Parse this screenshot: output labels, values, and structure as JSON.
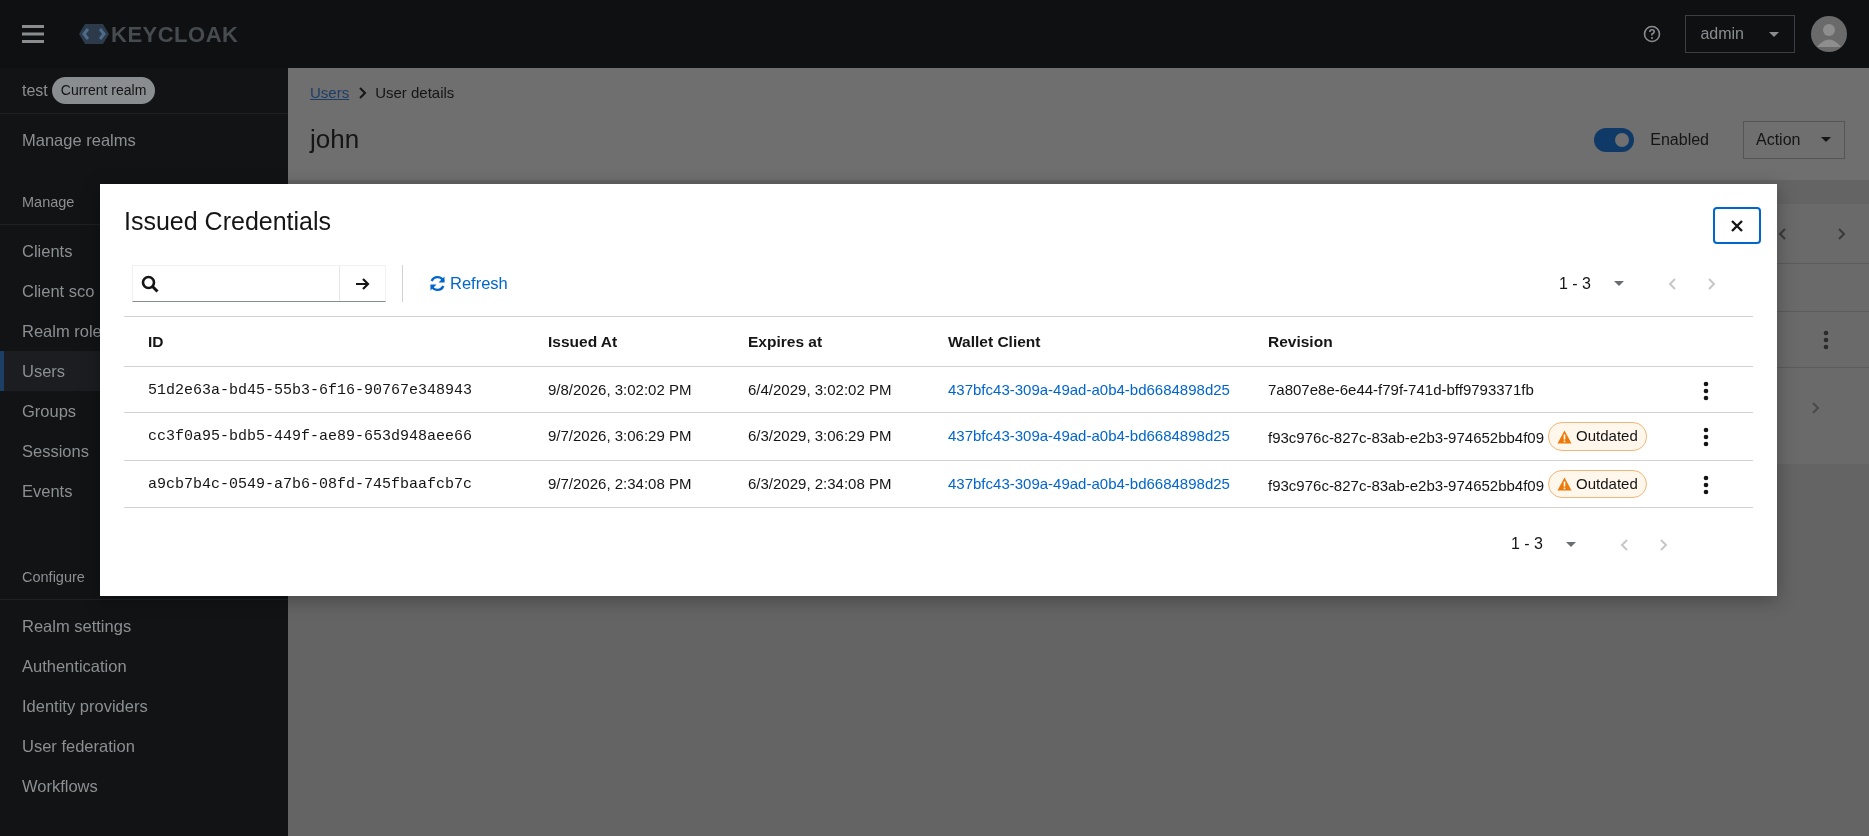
{
  "masthead": {
    "brand": "KEYCLOAK",
    "user": "admin"
  },
  "sidebar": {
    "realm": "test",
    "realm_badge": "Current realm",
    "manage_realms": "Manage realms",
    "sections": [
      {
        "title": "Manage",
        "items": [
          {
            "label": "Clients",
            "selected": false
          },
          {
            "label": "Client sco",
            "selected": false
          },
          {
            "label": "Realm role",
            "selected": false
          },
          {
            "label": "Users",
            "selected": true
          },
          {
            "label": "Groups",
            "selected": false
          },
          {
            "label": "Sessions",
            "selected": false
          },
          {
            "label": "Events",
            "selected": false
          }
        ]
      },
      {
        "title": "Configure",
        "items": [
          {
            "label": "Realm settings",
            "selected": false
          },
          {
            "label": "Authentication",
            "selected": false
          },
          {
            "label": "Identity providers",
            "selected": false
          },
          {
            "label": "User federation",
            "selected": false
          },
          {
            "label": "Workflows",
            "selected": false
          }
        ]
      }
    ]
  },
  "page": {
    "breadcrumb": [
      "Users",
      "User details"
    ],
    "title": "john",
    "enabled": {
      "on": true,
      "label": "Enabled"
    },
    "action": "Action"
  },
  "modal": {
    "title": "Issued Credentials",
    "refresh": "Refresh",
    "pagination_top": {
      "range": "1 - 3",
      "prev_disabled": true,
      "next_disabled": true
    },
    "columns": [
      "ID",
      "Issued At",
      "Expires at",
      "Wallet Client",
      "Revision"
    ],
    "rows": [
      {
        "id": "51d2e63a-bd45-55b3-6f16-90767e348943",
        "issued_at": "9/8/2026, 3:02:02 PM",
        "expires_at": "6/4/2029, 3:02:02 PM",
        "wallet_client": "437bfc43-309a-49ad-a0b4-bd6684898d25",
        "revision": "7a807e8e-6e44-f79f-741d-bff9793371fb",
        "outdated": false
      },
      {
        "id": "cc3f0a95-bdb5-449f-ae89-653d948aee66",
        "issued_at": "9/7/2026, 3:06:29 PM",
        "expires_at": "6/3/2029, 3:06:29 PM",
        "wallet_client": "437bfc43-309a-49ad-a0b4-bd6684898d25",
        "revision": "f93c976c-827c-83ab-e2b3-974652bb4f09",
        "outdated": true,
        "badge": "Outdated"
      },
      {
        "id": "a9cb7b4c-0549-a7b6-08fd-745fbaafcb7c",
        "issued_at": "9/7/2026, 2:34:08 PM",
        "expires_at": "6/3/2029, 2:34:08 PM",
        "wallet_client": "437bfc43-309a-49ad-a0b4-bd6684898d25",
        "revision": "f93c976c-827c-83ab-e2b3-974652bb4f09",
        "outdated": true,
        "badge": "Outdated"
      }
    ],
    "pagination_bottom": {
      "range": "1 - 3",
      "prev_disabled": true,
      "next_disabled": true
    }
  }
}
